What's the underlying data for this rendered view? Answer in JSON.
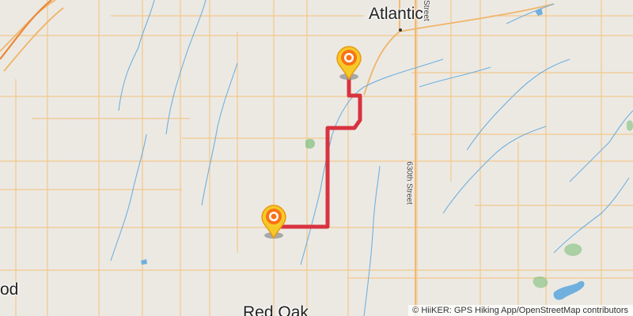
{
  "map": {
    "places": {
      "atlantic": "Atlantic",
      "red_oak": "Red Oak",
      "west_partial": "od"
    },
    "roads": {
      "street_630": "630th Street",
      "street_partial": "Street"
    },
    "markers": {
      "start_icon": "map-pin-icon",
      "end_icon": "map-pin-icon"
    },
    "colors": {
      "route": "#d8333f",
      "road": "#f3c37a",
      "water": "#4b9fd6",
      "background": "#ece9e3",
      "marker_outer": "#f59e0b",
      "marker_inner": "#ffffff",
      "marker_ring": "#f97316"
    },
    "attribution": {
      "copyright": "©",
      "text": "HiiKER: GPS Hiking App/OpenStreetMap contributors"
    }
  }
}
